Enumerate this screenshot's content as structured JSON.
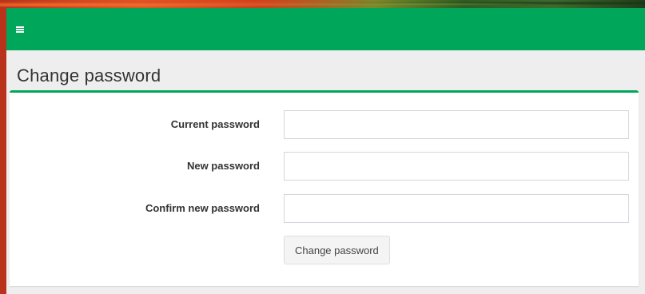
{
  "navbar": {
    "menu_icon": "hamburger-menu-icon",
    "color": "#00a65a"
  },
  "header": {
    "title": "Change password"
  },
  "form": {
    "fields": [
      {
        "label": "Current password",
        "value": "",
        "placeholder": ""
      },
      {
        "label": "New password",
        "value": "",
        "placeholder": ""
      },
      {
        "label": "Confirm new password",
        "value": "",
        "placeholder": ""
      }
    ],
    "submit_label": "Change password"
  },
  "colors": {
    "accent": "#00a65a",
    "background": "#eeeeee",
    "box": "#ffffff"
  }
}
